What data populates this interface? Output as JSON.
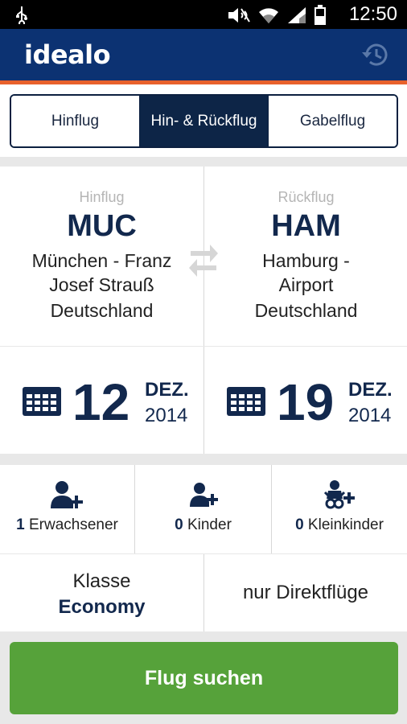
{
  "status_bar": {
    "time": "12:50",
    "icons": [
      "usb-icon",
      "mute-icon",
      "wifi-icon",
      "signal-icon",
      "battery-icon"
    ]
  },
  "app": {
    "logo": "idealo",
    "history_icon": "history-icon",
    "brand_color": "#0c3272",
    "accent_color": "#e8612c"
  },
  "trip_type": {
    "options": [
      "Hinflug",
      "Hin- & Rückflug",
      "Gabelflug"
    ],
    "selected": "Hin- & Rückflug"
  },
  "route": {
    "from": {
      "label": "Hinflug",
      "code": "MUC",
      "city_line1": "München - Franz",
      "city_line2": "Josef Strauß",
      "country": "Deutschland"
    },
    "to": {
      "label": "Rückflug",
      "code": "HAM",
      "city_line1": "Hamburg -",
      "city_line2": "Airport",
      "country": "Deutschland"
    }
  },
  "dates": {
    "outbound": {
      "day": "12",
      "month": "DEZ.",
      "year": "2014"
    },
    "return": {
      "day": "19",
      "month": "DEZ.",
      "year": "2014"
    }
  },
  "passengers": {
    "adults": {
      "count": "1",
      "label": "Erwachsener"
    },
    "children": {
      "count": "0",
      "label": "Kinder"
    },
    "infants": {
      "count": "0",
      "label": "Kleinkinder"
    }
  },
  "options": {
    "class_label": "Klasse",
    "class_value": "Economy",
    "direct_label": "nur Direktflüge"
  },
  "search": {
    "label": "Flug suchen",
    "color": "#56a23a"
  }
}
